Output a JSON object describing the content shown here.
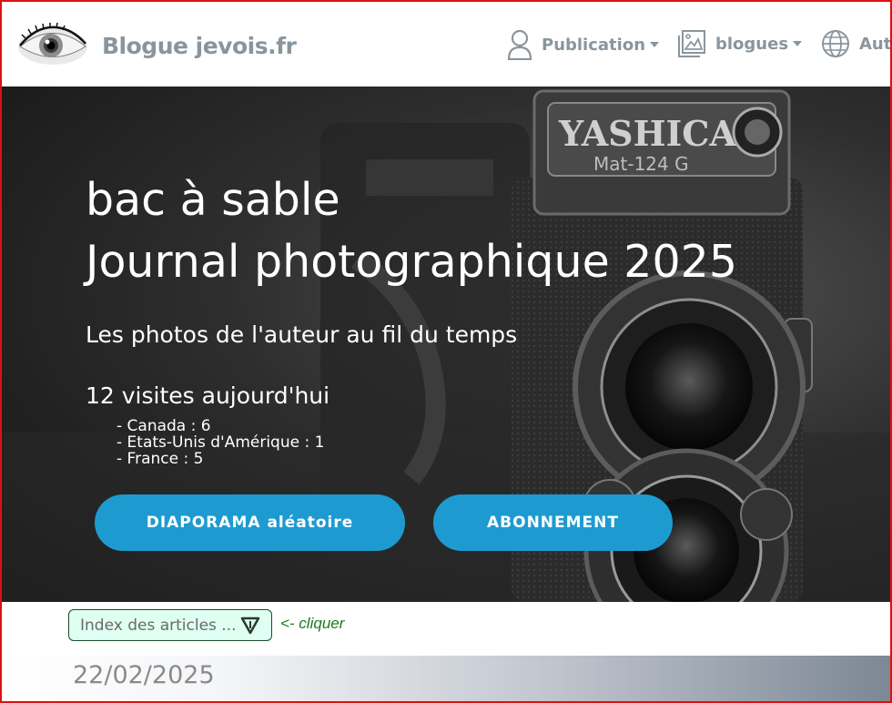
{
  "navbar": {
    "brand": "Blogue jevois.fr",
    "items": [
      {
        "label": "Publication",
        "icon": "user-icon",
        "has_caret": true
      },
      {
        "label": "blogues",
        "icon": "image-gallery-icon",
        "has_caret": true
      },
      {
        "label": "Aut",
        "icon": "globe-icon",
        "has_caret": false
      }
    ]
  },
  "hero": {
    "title_line1": "bac à sable",
    "title_line2": "Journal photographique 2025",
    "subtitle": "Les photos de l'auteur au fil du temps",
    "visits": "12 visites aujourd'hui",
    "visit_breakdown": [
      "- Canada : 6",
      "- Etats-Unis d'Amérique : 1",
      "- France : 5"
    ],
    "buttons": {
      "slideshow": "DIAPORAMA aléatoire",
      "subscribe": "ABONNEMENT"
    },
    "camera_brand": "YASHICA",
    "camera_model": "Mat-124 G"
  },
  "index": {
    "select_value": "Index des articles ...",
    "hint": "<- cliquer"
  },
  "post": {
    "date": "22/02/2025"
  },
  "colors": {
    "button": "#1d9bd0",
    "nav_text": "#8a959d",
    "select_bg": "#dffff2",
    "hint": "#1a7a1a",
    "frame": "#e01010"
  }
}
